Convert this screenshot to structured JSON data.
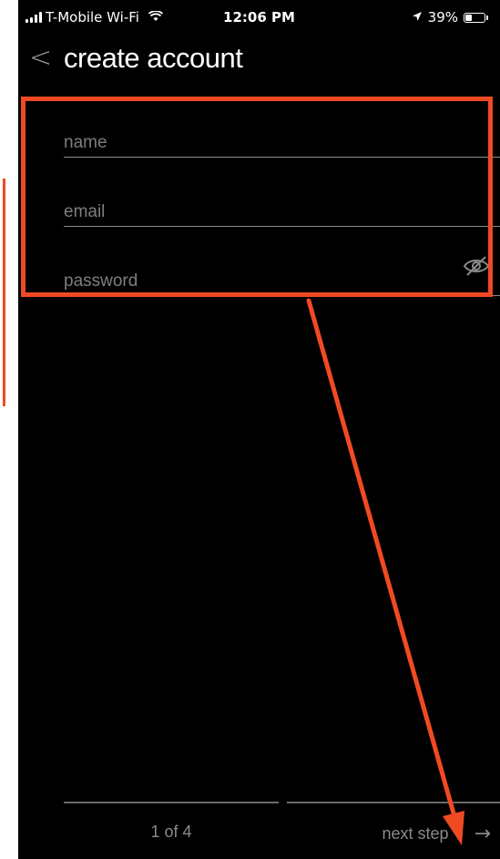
{
  "status_bar": {
    "carrier": "T-Mobile Wi-Fi",
    "time": "12:06 PM",
    "battery": "39%",
    "battery_level": 0.39,
    "icons": [
      "signal-icon",
      "wifi-icon",
      "location-arrow-icon",
      "battery-icon"
    ]
  },
  "header": {
    "back_glyph": "<",
    "title": "create account"
  },
  "form": {
    "name": {
      "placeholder": "name",
      "value": ""
    },
    "email": {
      "placeholder": "email",
      "value": ""
    },
    "password": {
      "placeholder": "password",
      "value": "",
      "toggle_icon": "eye-off-icon"
    }
  },
  "footer": {
    "step": "1 of 4",
    "next_label": "next step",
    "next_icon": "→"
  },
  "annotation": {
    "color": "#f04a23",
    "shapes": [
      "highlight-box",
      "side-marker",
      "arrow"
    ]
  },
  "colors": {
    "background": "#000000",
    "text": "#ffffff",
    "muted": "#8a8a8a"
  }
}
